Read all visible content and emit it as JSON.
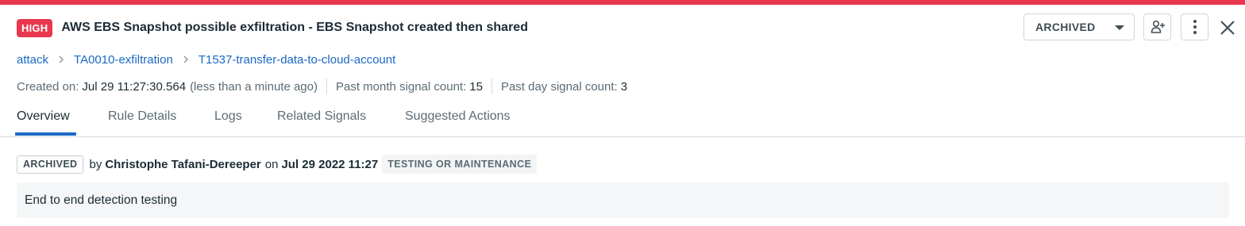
{
  "colors": {
    "severity_bar": "#e8384f",
    "link": "#1a69c4",
    "active_tab": "#1a69c4"
  },
  "signal": {
    "severity": "HIGH",
    "title": "AWS EBS Snapshot possible exfiltration - EBS Snapshot created then shared"
  },
  "actions": {
    "status_value": "ARCHIVED",
    "status_icon": "chevron-down-icon",
    "assign_icon": "add-user-icon",
    "more_icon": "more-vertical-icon",
    "close_icon": "close-icon"
  },
  "breadcrumb": [
    "attack",
    "TA0010-exfiltration",
    "T1537-transfer-data-to-cloud-account"
  ],
  "meta": {
    "created_label": "Created on:",
    "created_value": "Jul 29 11:27:30.564",
    "created_relative": "(less than a minute ago)",
    "month_label": "Past month signal count:",
    "month_value": "15",
    "day_label": "Past day signal count:",
    "day_value": "3"
  },
  "tabs": [
    "Overview",
    "Rule Details",
    "Logs",
    "Related Signals",
    "Suggested Actions"
  ],
  "active_tab": "Overview",
  "archive": {
    "badge": "ARCHIVED",
    "by": "by",
    "user": "Christophe Tafani-Dereeper",
    "on": "on",
    "date": "Jul 29 2022 11:27",
    "reason": "TESTING OR MAINTENANCE",
    "comment": "End to end detection testing"
  }
}
